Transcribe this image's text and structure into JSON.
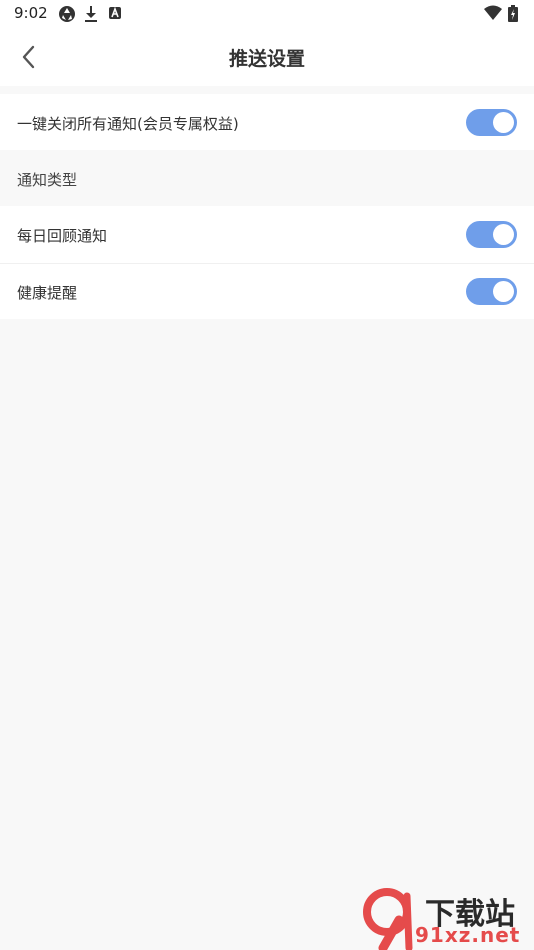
{
  "status_bar": {
    "time": "9:02",
    "left_icons": [
      "aperture-icon",
      "download-icon",
      "a-badge-icon"
    ],
    "right_icons": [
      "wifi-icon",
      "battery-icon"
    ]
  },
  "nav": {
    "title": "推送设置",
    "back_icon": "chevron-left-icon"
  },
  "settings": {
    "master": {
      "label": "一键关闭所有通知(会员专属权益)",
      "enabled": true
    },
    "section_title": "通知类型",
    "items": [
      {
        "label": "每日回顾通知",
        "enabled": true
      },
      {
        "label": "健康提醒",
        "enabled": true
      }
    ]
  },
  "watermark": {
    "top_text": "下载站",
    "bottom_text": "91xz.net",
    "logo_text": "9"
  },
  "colors": {
    "toggle_on": "#6f9eea",
    "background": "#f8f8f8",
    "watermark_red": "#e54b4b"
  }
}
